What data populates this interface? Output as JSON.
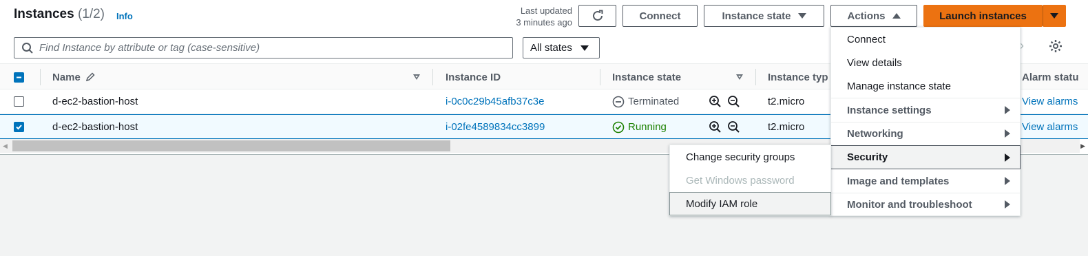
{
  "header": {
    "title": "Instances",
    "count": "(1/2)",
    "info_label": "Info",
    "last_updated_line1": "Last updated",
    "last_updated_line2": "3 minutes ago"
  },
  "toolbar": {
    "connect_label": "Connect",
    "instance_state_label": "Instance state",
    "actions_label": "Actions",
    "launch_label": "Launch instances"
  },
  "filter": {
    "search_placeholder": "Find Instance by attribute or tag (case-sensitive)",
    "state_filter_value": "All states"
  },
  "table": {
    "columns": [
      "Name",
      "Instance ID",
      "Instance state",
      "Instance typ",
      "Alarm statu"
    ],
    "rows": [
      {
        "selected": false,
        "name": "d-ec2-bastion-host",
        "instance_id": "i-0c0c29b45afb37c3e",
        "state": "Terminated",
        "type": "t2.micro",
        "alarm": "View alarms"
      },
      {
        "selected": true,
        "name": "d-ec2-bastion-host",
        "instance_id": "i-02fe4589834cc3899",
        "state": "Running",
        "type": "t2.micro",
        "alarm": "View alarms"
      }
    ]
  },
  "actions_menu": {
    "items": [
      {
        "label": "Connect"
      },
      {
        "label": "View details"
      },
      {
        "label": "Manage instance state"
      },
      {
        "label": "Instance settings"
      },
      {
        "label": "Networking"
      },
      {
        "label": "Security"
      },
      {
        "label": "Image and templates"
      },
      {
        "label": "Monitor and troubleshoot"
      }
    ]
  },
  "security_submenu": {
    "items": [
      {
        "label": "Change security groups"
      },
      {
        "label": "Get Windows password"
      },
      {
        "label": "Modify IAM role"
      }
    ]
  },
  "colors": {
    "accent": "#0073bb",
    "launch": "#ec7211",
    "running": "#1d8102",
    "terminated": "#545b64"
  }
}
